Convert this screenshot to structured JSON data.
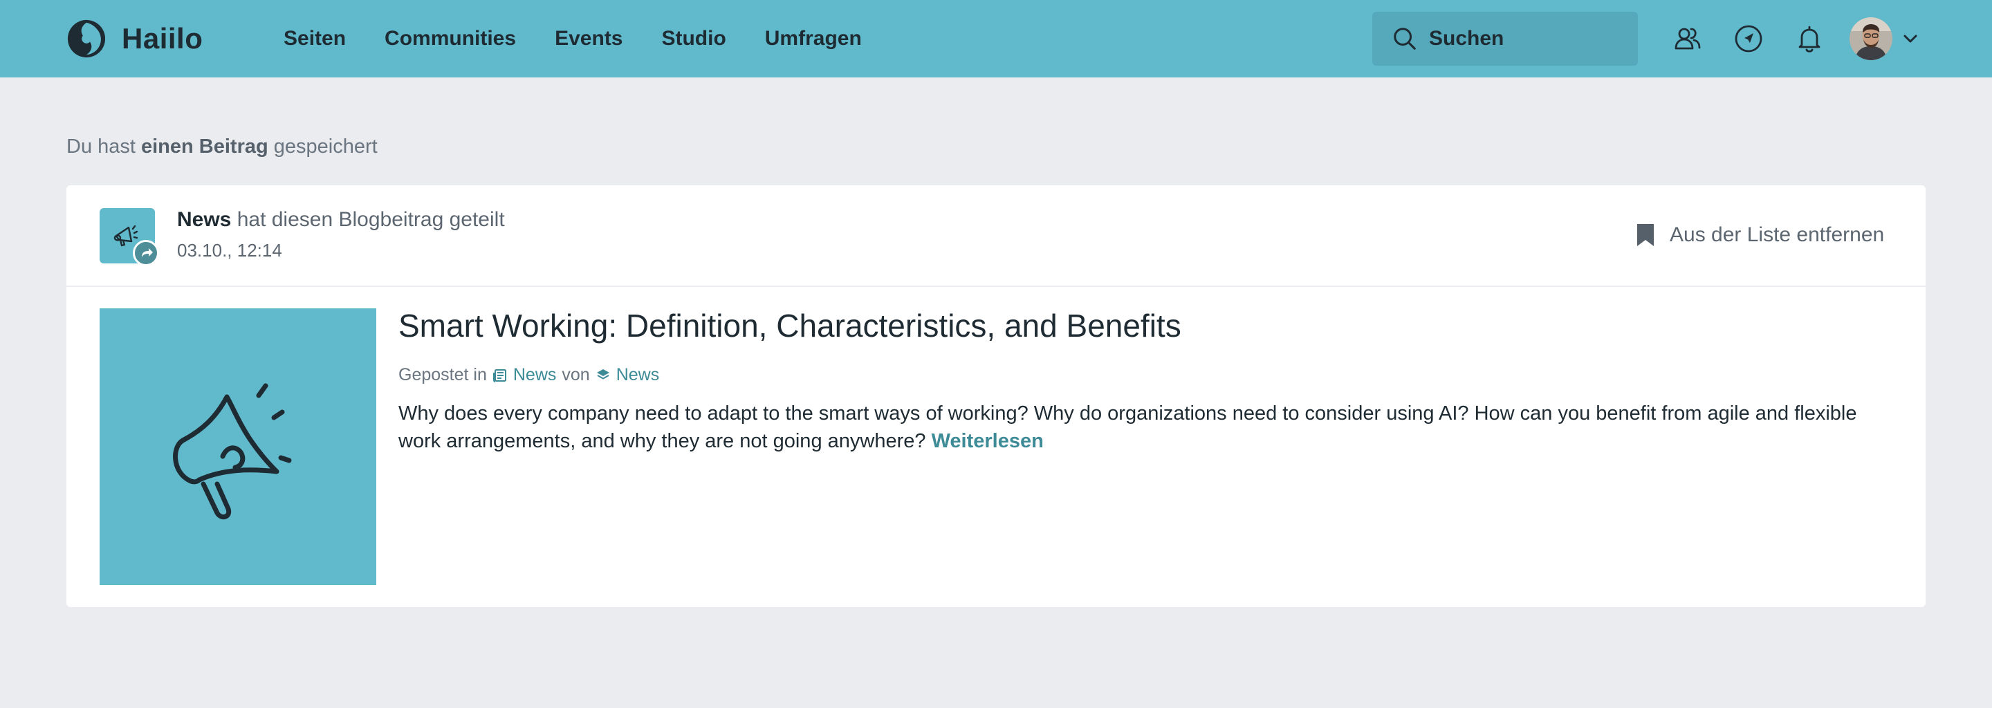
{
  "app": {
    "name": "Haiilo",
    "brand_color": "#61bacb",
    "brand_dark": "#1f2b33",
    "link_color": "#3d8b96"
  },
  "nav": {
    "items": [
      {
        "label": "Seiten"
      },
      {
        "label": "Communities"
      },
      {
        "label": "Events"
      },
      {
        "label": "Studio"
      },
      {
        "label": "Umfragen"
      }
    ]
  },
  "search": {
    "placeholder": "Suchen",
    "icon": "search-icon"
  },
  "header_icons": [
    "users-icon",
    "compass-icon",
    "bell-icon",
    "avatar",
    "chevron-down-icon"
  ],
  "saved": {
    "prefix": "Du hast ",
    "bold": "einen Beitrag",
    "suffix": " gespeichert"
  },
  "card": {
    "sender": "News",
    "action": " hat diesen Blogbeitrag geteilt",
    "date": "03.10., 12:14",
    "remove_label": "Aus der Liste entfernen",
    "post": {
      "title": "Smart Working: Definition, Characteristics, and Benefits",
      "posted_in_label": "Gepostet in",
      "channel": "News",
      "by_label": "von",
      "author": "News",
      "excerpt": "Why does every company need to adapt to the smart ways of working? Why do organizations need to consider using AI? How can you benefit from agile and flexible work arrangements, and why they are not going anywhere?",
      "read_more": "Weiterlesen"
    }
  }
}
